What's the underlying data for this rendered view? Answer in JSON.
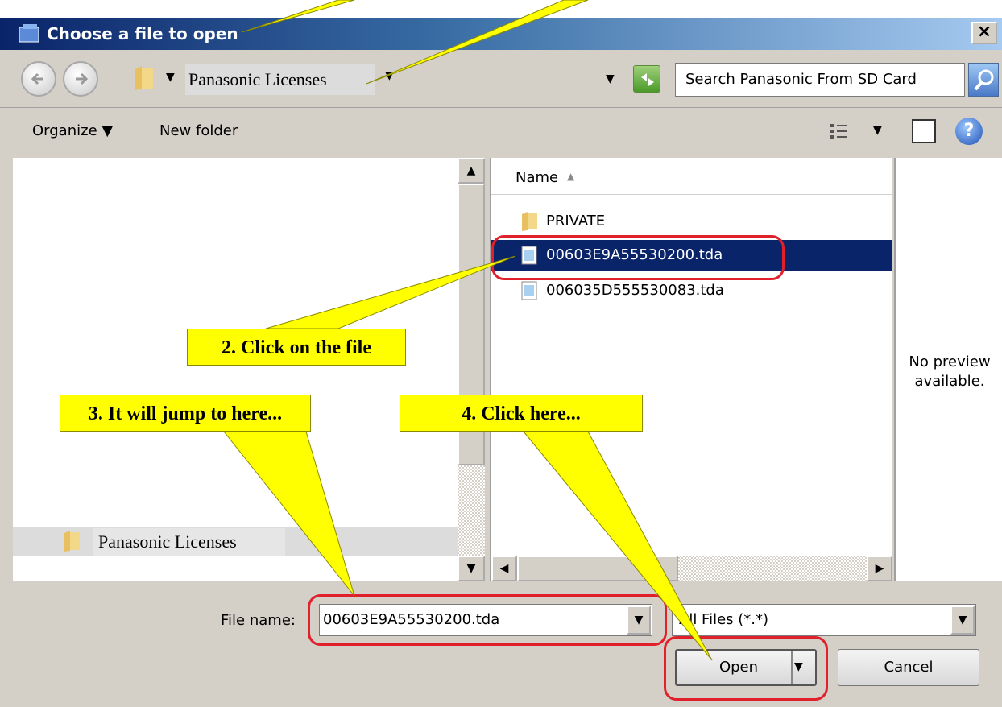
{
  "window": {
    "title": "Choose a file to open",
    "close_label": "×"
  },
  "address_bar": {
    "crumb": "Panasonic Licenses",
    "search_placeholder": "Search Panasonic From SD Card"
  },
  "toolbar": {
    "organize_label": "Organize ▼",
    "new_folder_label": "New folder"
  },
  "nav_pane": {
    "selected_folder": "Panasonic Licenses"
  },
  "file_list": {
    "column_name": "Name",
    "items": [
      {
        "name": "PRIVATE",
        "type": "folder"
      },
      {
        "name": "00603E9A55530200.tda",
        "type": "file",
        "selected": true
      },
      {
        "name": "006035D555530083.tda",
        "type": "file"
      }
    ]
  },
  "preview": {
    "message": "No preview available."
  },
  "bottom": {
    "filename_label": "File name:",
    "filename_value": "00603E9A55530200.tda",
    "filter_value": "All Files (*.*)",
    "open_label": "Open",
    "cancel_label": "Cancel"
  },
  "callouts": {
    "c2": "2. Click on the file",
    "c3": "3. It will jump to here...",
    "c4": "4. Click here..."
  },
  "colors": {
    "selection": "#0a246a",
    "highlight": "#e0202a",
    "callout": "#ffff00"
  }
}
